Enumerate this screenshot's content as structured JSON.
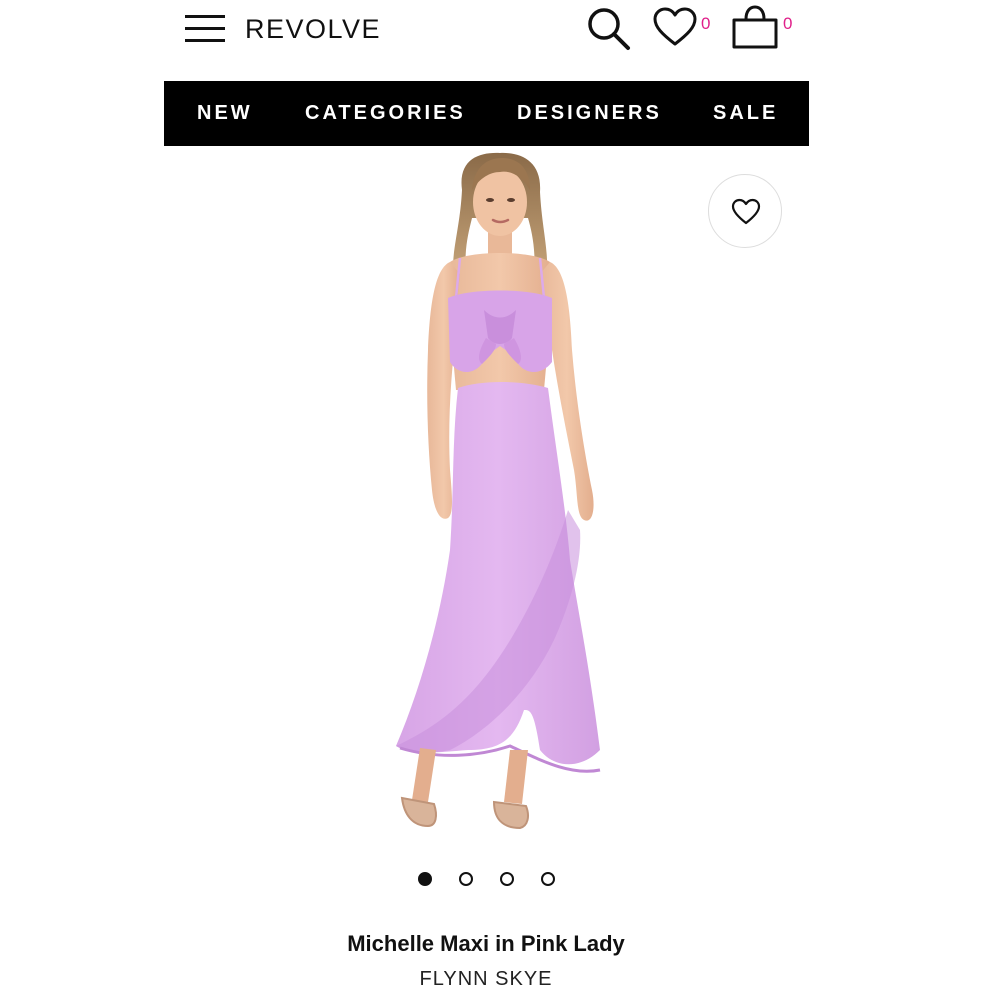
{
  "header": {
    "logo": "REVOLVE",
    "icons": {
      "menu": "hamburger-menu-icon",
      "search": "search-icon",
      "wishlist": "heart-icon",
      "bag": "shopping-bag-icon"
    },
    "wishlist_count": "0",
    "bag_count": "0",
    "count_color": "#e0208a"
  },
  "nav": {
    "background": "#000000",
    "items": [
      {
        "label": "NEW"
      },
      {
        "label": "CATEGORIES"
      },
      {
        "label": "DESIGNERS"
      },
      {
        "label": "SALE"
      }
    ]
  },
  "product": {
    "image": {
      "subject": "model wearing lilac tie-front crop top and ruffled maxi skirt",
      "color": "#dcaeea"
    },
    "favorite_icon": "heart-outline-icon",
    "carousel": {
      "total": 4,
      "active_index": 0
    },
    "title": "Michelle Maxi in Pink Lady",
    "brand": "FLYNN SKYE"
  }
}
